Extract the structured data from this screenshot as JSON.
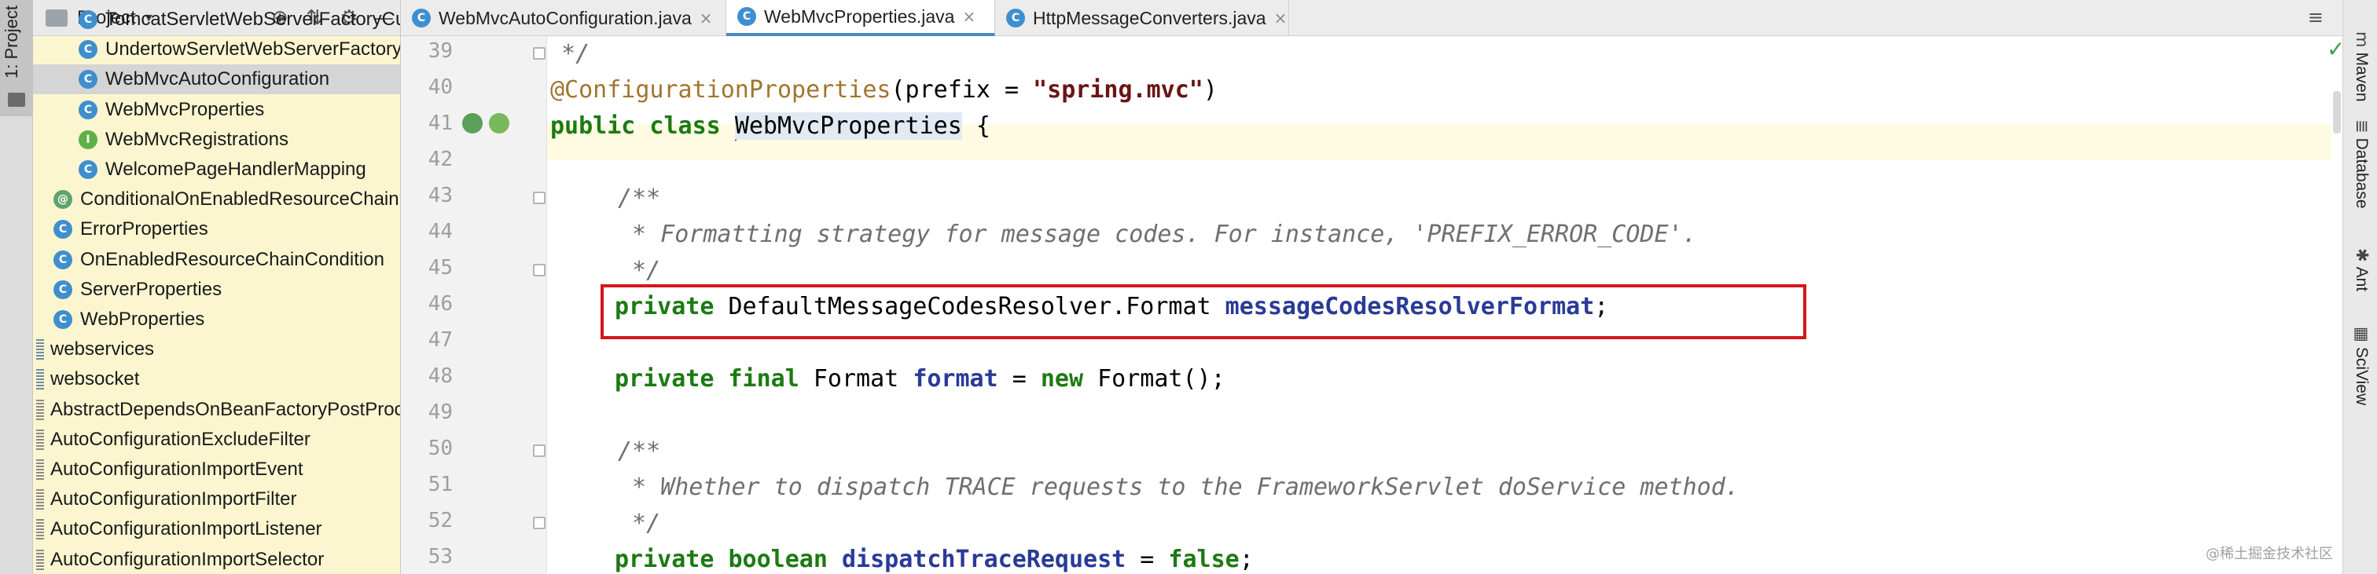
{
  "left_strip": {
    "tab_label": "1: Project"
  },
  "project_panel": {
    "title": "Project",
    "caret": "▾",
    "toolbar_icons": [
      "crosshair-icon",
      "collapse-icon",
      "gear-icon",
      "minimize-icon"
    ],
    "toolbar_glyphs": [
      "⊕",
      "⇅",
      "⚙",
      "—"
    ],
    "tree": [
      {
        "label": "TomcatServletWebServerFactoryCustomizer",
        "icon": "C",
        "indent": 1
      },
      {
        "label": "UndertowServletWebServerFactoryCustomizer",
        "icon": "C",
        "indent": 1
      },
      {
        "label": "WebMvcAutoConfiguration",
        "icon": "C",
        "indent": 1,
        "selected": true
      },
      {
        "label": "WebMvcProperties",
        "icon": "C",
        "indent": 1
      },
      {
        "label": "WebMvcRegistrations",
        "icon": "I",
        "indent": 1
      },
      {
        "label": "WelcomePageHandlerMapping",
        "icon": "C",
        "indent": 1
      },
      {
        "label": "ConditionalOnEnabledResourceChain",
        "icon": "@",
        "indent": 0
      },
      {
        "label": "ErrorProperties",
        "icon": "C",
        "indent": 0
      },
      {
        "label": "OnEnabledResourceChainCondition",
        "icon": "C",
        "indent": 0
      },
      {
        "label": "ServerProperties",
        "icon": "C",
        "indent": 0
      },
      {
        "label": "WebProperties",
        "icon": "C",
        "indent": 0
      },
      {
        "label": "webservices",
        "icon": "folder",
        "indent": -1
      },
      {
        "label": "websocket",
        "icon": "folder",
        "indent": -1
      },
      {
        "label": "AbstractDependsOnBeanFactoryPostProcessor",
        "icon": "pkg",
        "indent": -1
      },
      {
        "label": "AutoConfigurationExcludeFilter",
        "icon": "pkg",
        "indent": -1
      },
      {
        "label": "AutoConfigurationImportEvent",
        "icon": "pkg",
        "indent": -1
      },
      {
        "label": "AutoConfigurationImportFilter",
        "icon": "pkg",
        "indent": -1
      },
      {
        "label": "AutoConfigurationImportListener",
        "icon": "pkg",
        "indent": -1
      },
      {
        "label": "AutoConfigurationImportSelector",
        "icon": "pkg",
        "indent": -1
      }
    ]
  },
  "tabs": [
    {
      "label": "WebMvcAutoConfiguration.java",
      "active": false,
      "close": "×"
    },
    {
      "label": "WebMvcProperties.java",
      "active": true,
      "close": "×"
    },
    {
      "label": "HttpMessageConverters.java",
      "active": false,
      "close": "×"
    }
  ],
  "tab_menu": "≡",
  "editor": {
    "line_numbers": [
      "39",
      "40",
      "41",
      "42",
      "43",
      "44",
      "45",
      "46",
      "47",
      "48",
      "49",
      "50",
      "51",
      "52",
      "53"
    ],
    "lines": {
      "l39": " */",
      "l40_ann": "@ConfigurationProperties",
      "l40_a": "(prefix = ",
      "l40_str": "\"spring.mvc\"",
      "l40_b": ")",
      "l41_kw": "public class ",
      "l41_cls": "WebMvcProperties",
      "l41_rest": " {",
      "l43": "/**",
      "l44": " * Formatting strategy for message codes. For instance, 'PREFIX_ERROR_CODE'.",
      "l45": " */",
      "l46_kw": "private ",
      "l46_type": "DefaultMessageCodesResolver.Format ",
      "l46_field": "messageCodesResolverFormat",
      "l46_end": ";",
      "l48_kw1": "private final ",
      "l48_type": "Format ",
      "l48_field": "format",
      "l48_eq": " = ",
      "l48_kw2": "new ",
      "l48_end": "Format();",
      "l50": "/**",
      "l51": " * Whether to dispatch TRACE requests to the FrameworkServlet doService method.",
      "l52": " */",
      "l53_kw": "private boolean ",
      "l53_field": "dispatchTraceRequest",
      "l53_eq": " = ",
      "l53_val": "false",
      "l53_end": ";"
    },
    "inspection_status": "✓",
    "highlight_color": "#d7151b"
  },
  "right_strip": [
    {
      "icon": "maven-icon",
      "glyph": "m",
      "label": "Maven"
    },
    {
      "icon": "database-icon",
      "glyph": "≣",
      "label": "Database"
    },
    {
      "icon": "ant-icon",
      "glyph": "✱",
      "label": "Ant"
    },
    {
      "icon": "sciview-icon",
      "glyph": "▦",
      "label": "SciView"
    }
  ],
  "watermark": "@稀土掘金技术社区"
}
